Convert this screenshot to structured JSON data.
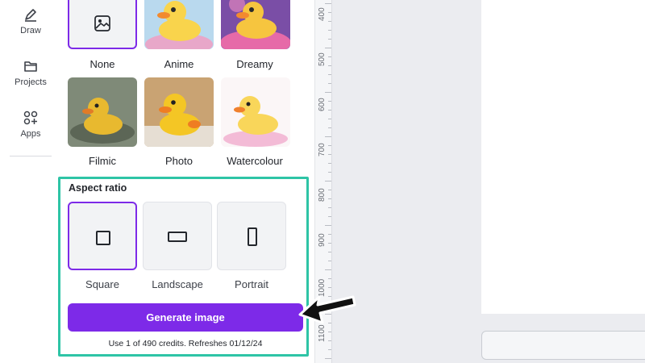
{
  "rail": {
    "items": [
      {
        "label": "Draw",
        "icon": "pen-icon"
      },
      {
        "label": "Projects",
        "icon": "folder-icon"
      },
      {
        "label": "Apps",
        "icon": "apps-icon"
      }
    ]
  },
  "styles": [
    {
      "label": "None",
      "icon": "image-icon"
    },
    {
      "label": "Anime"
    },
    {
      "label": "Dreamy"
    },
    {
      "label": "Filmic"
    },
    {
      "label": "Photo"
    },
    {
      "label": "Watercolour"
    }
  ],
  "aspect": {
    "title": "Aspect ratio",
    "options": [
      {
        "label": "Square",
        "selected": true
      },
      {
        "label": "Landscape",
        "selected": false
      },
      {
        "label": "Portrait",
        "selected": false
      }
    ]
  },
  "generate": {
    "label": "Generate image",
    "credits": "Use 1 of 490 credits. Refreshes 01/12/24"
  },
  "ruler": {
    "marks": [
      "400",
      "500",
      "600",
      "700",
      "800",
      "900",
      "1000",
      "1100"
    ]
  },
  "colors": {
    "accent": "#7d2ae8",
    "highlight": "#2ec4a6"
  }
}
